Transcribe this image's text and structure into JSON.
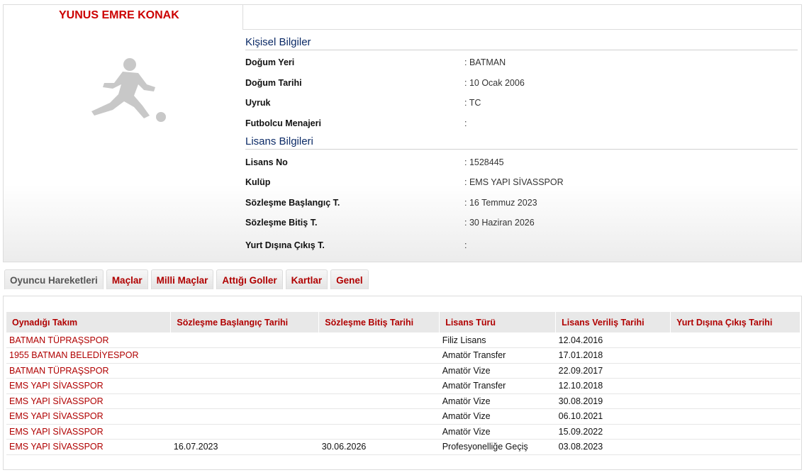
{
  "player": {
    "name": "YUNUS EMRE KONAK"
  },
  "personal": {
    "title": "Kişisel Bilgiler",
    "rows": [
      {
        "label": "Doğum Yeri",
        "value": ":  BATMAN"
      },
      {
        "label": "Doğum Tarihi",
        "value": ":  10 Ocak 2006"
      },
      {
        "label": "Uyruk",
        "value": ":  TC"
      },
      {
        "label": "Futbolcu Menajeri",
        "value": ":"
      }
    ]
  },
  "license": {
    "title": "Lisans Bilgileri",
    "rows": [
      {
        "label": "Lisans No",
        "value": ": 1528445"
      },
      {
        "label": "Kulüp",
        "value": ": EMS YAPI SİVASSPOR"
      },
      {
        "label": "Sözleşme Başlangıç T.",
        "value": ": 16 Temmuz 2023"
      },
      {
        "label": "Sözleşme Bitiş T.",
        "value": ": 30 Haziran 2026"
      },
      {
        "label": "Yurt Dışına Çıkış T.",
        "value": ":"
      }
    ]
  },
  "tabs": [
    "Oyuncu Hareketleri",
    "Maçlar",
    "Milli Maçlar",
    "Attığı Goller",
    "Kartlar",
    "Genel"
  ],
  "table": {
    "headers": [
      "Oynadığı Takım",
      "Sözleşme Başlangıç Tarihi",
      "Sözleşme Bitiş Tarihi",
      "Lisans Türü",
      "Lisans Veriliş Tarihi",
      "Yurt Dışına Çıkış Tarihi"
    ],
    "rows": [
      [
        "BATMAN TÜPRAŞSPOR",
        "",
        "",
        "Filiz Lisans",
        "12.04.2016",
        ""
      ],
      [
        "1955 BATMAN BELEDİYESPOR",
        "",
        "",
        "Amatör Transfer",
        "17.01.2018",
        ""
      ],
      [
        "BATMAN TÜPRAŞSPOR",
        "",
        "",
        "Amatör Vize",
        "22.09.2017",
        ""
      ],
      [
        "EMS YAPI SİVASSPOR",
        "",
        "",
        "Amatör Transfer",
        "12.10.2018",
        ""
      ],
      [
        "EMS YAPI SİVASSPOR",
        "",
        "",
        "Amatör Vize",
        "30.08.2019",
        ""
      ],
      [
        "EMS YAPI SİVASSPOR",
        "",
        "",
        "Amatör Vize",
        "06.10.2021",
        ""
      ],
      [
        "EMS YAPI SİVASSPOR",
        "",
        "",
        "Amatör Vize",
        "15.09.2022",
        ""
      ],
      [
        "EMS YAPI SİVASSPOR",
        "16.07.2023",
        "30.06.2026",
        "Profesyonelliğe Geçiş",
        "03.08.2023",
        ""
      ]
    ]
  }
}
